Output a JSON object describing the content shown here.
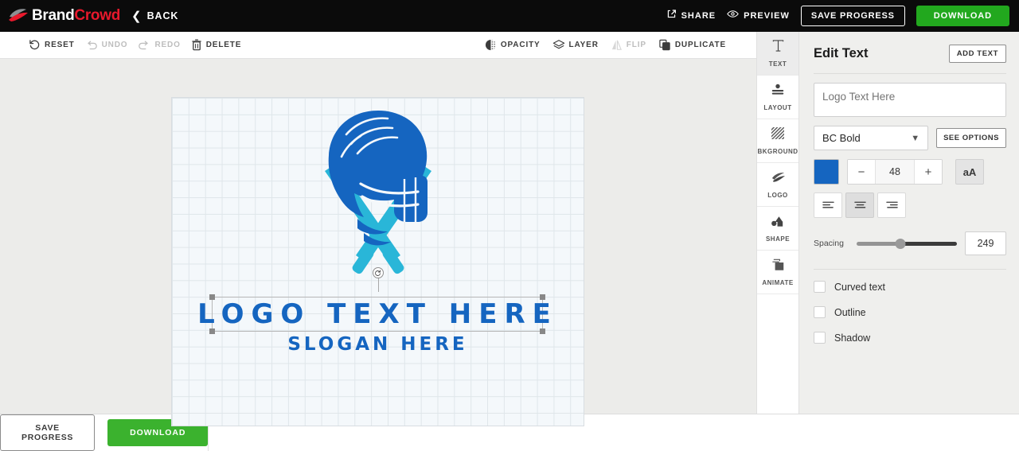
{
  "header": {
    "brand_first": "Brand",
    "brand_second": "Crowd",
    "brand_icon": "brandcrowd-swoosh-icon",
    "back_label": "BACK",
    "back_icon": "chevron-left-icon",
    "share_label": "SHARE",
    "share_icon": "share-icon",
    "preview_label": "PREVIEW",
    "preview_icon": "eye-icon",
    "save_label": "SAVE PROGRESS",
    "download_label": "DOWNLOAD",
    "download_color": "#22a81e"
  },
  "toolbar": {
    "left": [
      {
        "label": "RESET",
        "icon": "reset-icon",
        "disabled": false
      },
      {
        "label": "UNDO",
        "icon": "undo-icon",
        "disabled": true
      },
      {
        "label": "REDO",
        "icon": "redo-icon",
        "disabled": true
      },
      {
        "label": "DELETE",
        "icon": "trash-icon",
        "disabled": false
      }
    ],
    "right": [
      {
        "label": "OPACITY",
        "icon": "opacity-icon",
        "disabled": false
      },
      {
        "label": "LAYER",
        "icon": "layers-icon",
        "disabled": false
      },
      {
        "label": "FLIP",
        "icon": "flip-icon",
        "disabled": true
      },
      {
        "label": "DUPLICATE",
        "icon": "duplicate-icon",
        "disabled": false
      }
    ]
  },
  "canvas": {
    "logo_text": "LOGO TEXT HERE",
    "slogan_text": "SLOGAN HERE",
    "text_color": "#1565c0",
    "emblem_name": "cricket-helmet-and-bats-emblem",
    "emblem_dark_color": "#1565c0",
    "emblem_light_color": "#29b6d8",
    "background_color": "#f4f8fb",
    "grid_color": "#dfe6ea",
    "selection_active": true
  },
  "iconbar": {
    "items": [
      {
        "label": "TEXT",
        "icon": "text-icon",
        "active": true
      },
      {
        "label": "LAYOUT",
        "icon": "layout-icon",
        "active": false
      },
      {
        "label": "BKGROUND",
        "icon": "background-icon",
        "active": false
      },
      {
        "label": "LOGO",
        "icon": "logo-icon",
        "active": false
      },
      {
        "label": "SHAPE",
        "icon": "shape-icon",
        "active": false
      },
      {
        "label": "ANIMATE",
        "icon": "animate-icon",
        "active": false
      }
    ]
  },
  "panel": {
    "title": "Edit Text",
    "add_text_label": "ADD TEXT",
    "textarea_placeholder": "Logo Text Here",
    "textarea_value": "",
    "font_value": "BC Bold",
    "see_options_label": "SEE OPTIONS",
    "color_value": "#1565c0",
    "size_value": "48",
    "minus_label": "−",
    "plus_label": "+",
    "case_label": "aA",
    "align_options": [
      {
        "name": "align-left",
        "active": false
      },
      {
        "name": "align-center",
        "active": true
      },
      {
        "name": "align-right",
        "active": false
      }
    ],
    "spacing_label": "Spacing",
    "spacing_value": "249",
    "spacing_percent": 44,
    "checkboxes": [
      {
        "label": "Curved text",
        "checked": false
      },
      {
        "label": "Outline",
        "checked": false
      },
      {
        "label": "Shadow",
        "checked": false
      }
    ]
  },
  "footer": {
    "save_label": "SAVE PROGRESS",
    "download_label": "DOWNLOAD",
    "download_color": "#3bb22e"
  }
}
